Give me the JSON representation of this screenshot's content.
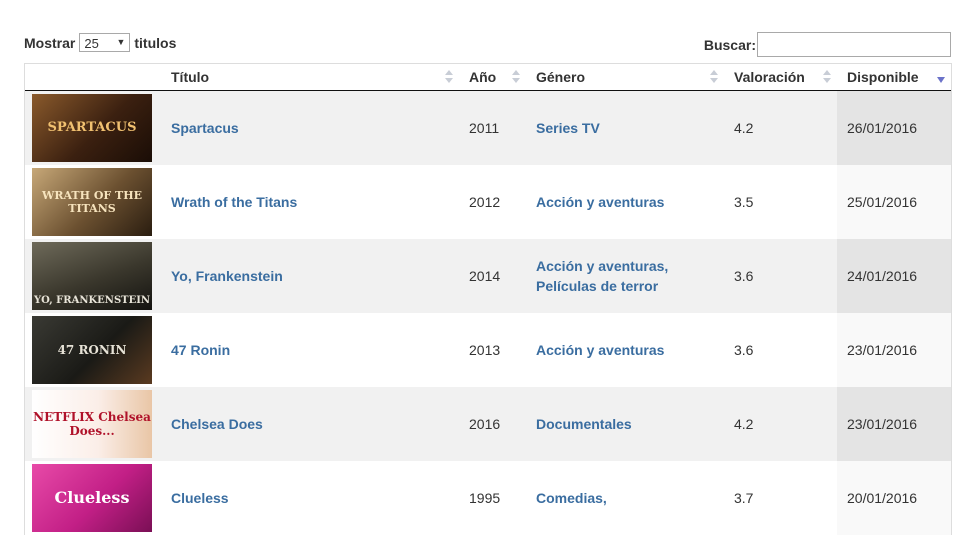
{
  "length_control": {
    "label_before": "Mostrar",
    "selected": "25",
    "label_after": "titulos"
  },
  "search": {
    "label": "Buscar:",
    "value": "",
    "placeholder": ""
  },
  "table": {
    "columns": [
      "Título",
      "Año",
      "Género",
      "Valoración",
      "Disponible"
    ],
    "sorted_column": "Disponible",
    "sort_direction": "desc",
    "rows": [
      {
        "poster_text": "SPARTACUS",
        "title": "Spartacus",
        "year": "2011",
        "genre_line1": "Series TV",
        "genre_line2": "",
        "rating": "4.2",
        "available": "26/01/2016"
      },
      {
        "poster_text": "WRATH OF THE TITANS",
        "title": "Wrath of the Titans",
        "year": "2012",
        "genre_line1": "Acción y aventuras",
        "genre_line2": "",
        "rating": "3.5",
        "available": "25/01/2016"
      },
      {
        "poster_text": "YO, FRANKENSTEIN",
        "title": "Yo, Frankenstein",
        "year": "2014",
        "genre_line1": "Acción y aventuras,",
        "genre_line2": "Películas de terror",
        "rating": "3.6",
        "available": "24/01/2016"
      },
      {
        "poster_text": "47 RONIN",
        "title": "47 Ronin",
        "year": "2013",
        "genre_line1": "Acción y aventuras",
        "genre_line2": "",
        "rating": "3.6",
        "available": "23/01/2016"
      },
      {
        "poster_text": "NETFLIX Chelsea Does...",
        "title": "Chelsea Does",
        "year": "2016",
        "genre_line1": "Documentales",
        "genre_line2": "",
        "rating": "4.2",
        "available": "23/01/2016"
      },
      {
        "poster_text": "Clueless",
        "title": "Clueless",
        "year": "1995",
        "genre_line1": "Comedias,",
        "genre_line2": "",
        "rating": "3.7",
        "available": "20/01/2016"
      }
    ]
  },
  "colors": {
    "link": "#3a6da0",
    "odd_row": "#f1f1f1",
    "sorted_odd": "#e4e4e4",
    "sort_active": "#6b72c9"
  }
}
